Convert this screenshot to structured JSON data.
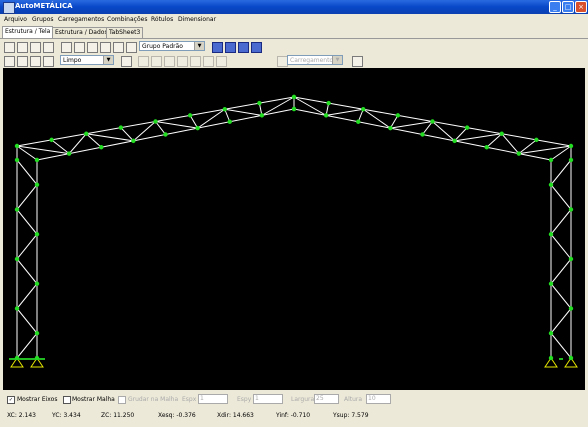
{
  "window": {
    "title": "AutoMETÁLICA"
  },
  "menu": [
    "Arquivo",
    "Grupos",
    "Carregamentos",
    "Combinações",
    "Rótulos",
    "Dimensionar"
  ],
  "tabs": [
    "Estrutura / Tela",
    "Estrutura / Dados",
    "TabSheet3"
  ],
  "toolbar1": {
    "group_select": "Grupo Padrão"
  },
  "toolbar2": {
    "view_select": "Limpo",
    "load_select": "Carregamento P"
  },
  "bottom": {
    "show_axes": "Mostrar Eixos",
    "show_mesh": "Mostrar Malha",
    "mesh_grid": "Grudar na Malha",
    "espx_label": "Espx",
    "espx_value": "1",
    "espy_label": "Espy",
    "espy_value": "1",
    "largura_label": "Largura",
    "largura_value": "25",
    "altura_label": "Altura",
    "altura_value": "10"
  },
  "status": {
    "xc": "XC: 2.143",
    "yc": "YC: 3.434",
    "zc": "ZC: 11.250",
    "xesq": "Xesq: -0.376",
    "xdir": "Xdir: 14.663",
    "yinf": "Yinf: -0.710",
    "ysup": "Ysup: 7.579"
  },
  "colors": {
    "truss": "#ffffff",
    "node": "#22dd22",
    "support": "#e6e600"
  }
}
